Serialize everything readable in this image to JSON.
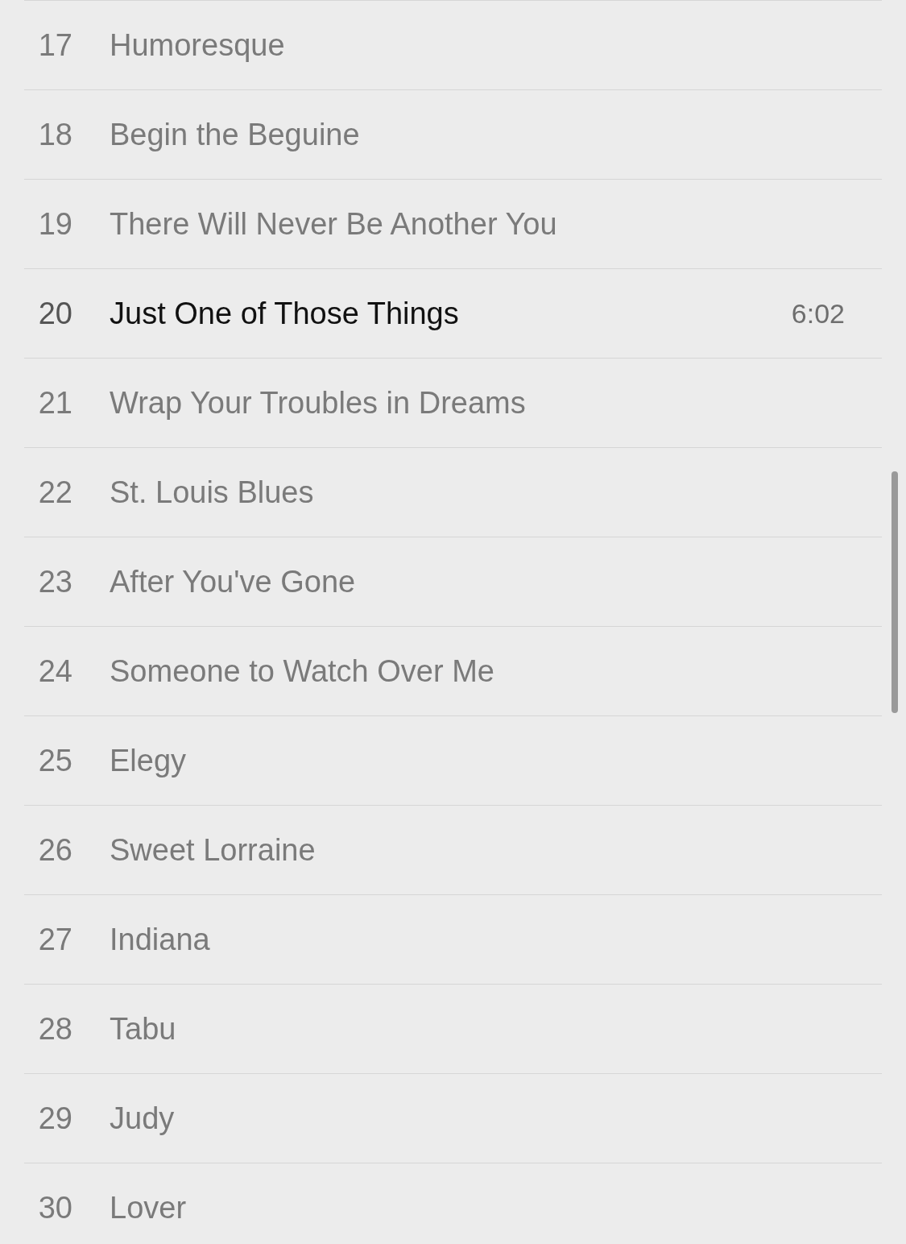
{
  "tracks": [
    {
      "number": "17",
      "title": "Humoresque",
      "selected": false
    },
    {
      "number": "18",
      "title": "Begin the Beguine",
      "selected": false
    },
    {
      "number": "19",
      "title": "There Will Never Be Another You",
      "selected": false
    },
    {
      "number": "20",
      "title": "Just One of Those Things",
      "selected": true,
      "duration": "6:02"
    },
    {
      "number": "21",
      "title": "Wrap Your Troubles in Dreams",
      "selected": false
    },
    {
      "number": "22",
      "title": "St. Louis Blues",
      "selected": false
    },
    {
      "number": "23",
      "title": "After You've Gone",
      "selected": false
    },
    {
      "number": "24",
      "title": "Someone to Watch Over Me",
      "selected": false
    },
    {
      "number": "25",
      "title": "Elegy",
      "selected": false
    },
    {
      "number": "26",
      "title": "Sweet Lorraine",
      "selected": false
    },
    {
      "number": "27",
      "title": "Indiana",
      "selected": false
    },
    {
      "number": "28",
      "title": "Tabu",
      "selected": false
    },
    {
      "number": "29",
      "title": "Judy",
      "selected": false
    },
    {
      "number": "30",
      "title": "Lover",
      "selected": false
    }
  ]
}
